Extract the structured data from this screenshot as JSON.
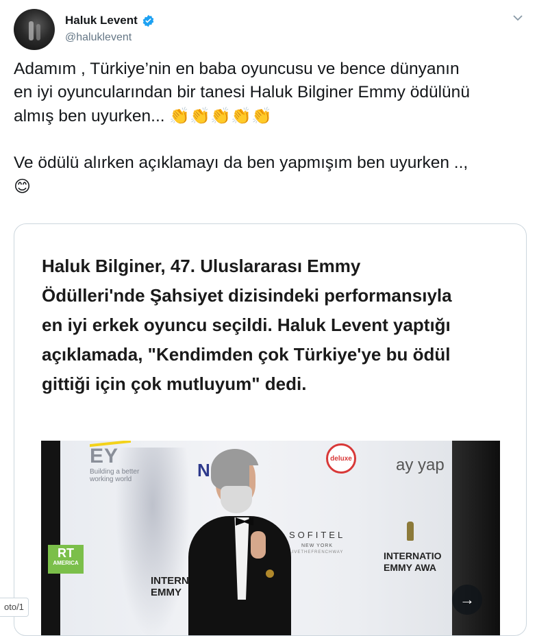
{
  "tweet": {
    "author": {
      "display_name": "Haluk Levent",
      "handle": "@haluklevent",
      "verified": true
    },
    "text_line1": "Adamım , Türkiye’nin en baba oyuncusu ve bence dünyanın",
    "text_line2": "en iyi oyuncularından bir tanesi Haluk Bilginer Emmy ödülünü",
    "text_line3": "almış ben uyurken...",
    "clap_emojis": "👏👏👏👏👏",
    "text_line4": "Ve ödülü alırken açıklamayı da ben yapmışım ben uyurken ..,",
    "smile_emoji": "😊",
    "icons": [
      "verified-badge-icon",
      "caret-down-icon",
      "clapping-hands-icon",
      "smiling-face-icon",
      "arrow-right-icon"
    ]
  },
  "card": {
    "headline_line1": "Haluk Bilginer, 47. Uluslararası Emmy",
    "headline_line2": "Ödülleri'nde Şahsiyet dizisindeki performansıyla",
    "headline_line3": "en iyi erkek oyuncu seçildi. Haluk Levent yaptığı",
    "headline_line4": "açıklamada, \"Kendimden çok Türkiye'ye bu ödül",
    "headline_line5": "gittiği için çok mutluyum\" dedi.",
    "photo": {
      "ey_logo": "EY",
      "ey_tagline": "Building a better working world",
      "nyt_partial": "NYT.",
      "deluxe": "deluxe",
      "ay_yap": "ay yap",
      "rt_logo": "RT",
      "rt_sub": "AMERICA",
      "intl_emmy_left": "INTERN\nEMMY",
      "sofitel": "SOFITEL",
      "sofitel_city": "NEW YORK",
      "sofitel_tag": "#LIVETHEFRENCHWAY",
      "intl_emmy_right": "INTERNATIO\nEMMY AWA"
    }
  },
  "photo_counter": "oto/1",
  "colors": {
    "text": "#14171a",
    "secondary": "#657786",
    "verified": "#1da1f2",
    "card_border": "#ccd6dd"
  }
}
